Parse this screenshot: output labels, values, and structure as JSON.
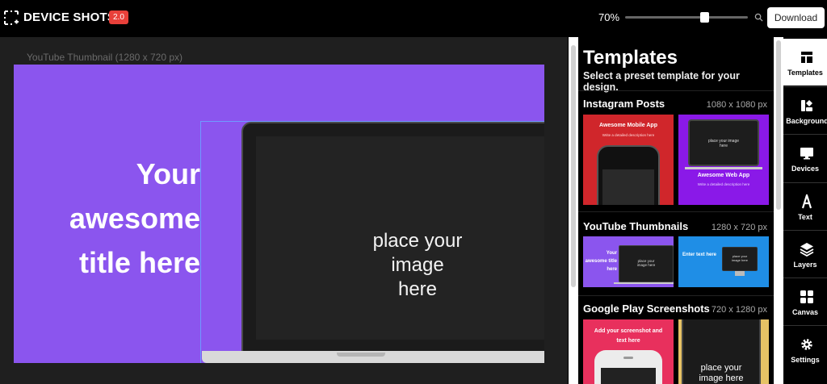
{
  "app": {
    "name": "DEVICE SHOTS",
    "version": "2.0"
  },
  "toolbar": {
    "zoom": "70%",
    "zoom_value": 0.7,
    "download_label": "Download"
  },
  "canvas": {
    "title": "YouTube Thumbnail (1280 x 720 px)",
    "headline_lines": [
      "Your",
      "awesome",
      "title here"
    ],
    "placeholder_lines": [
      "place your",
      "image here"
    ],
    "background_color": "#8b55ee"
  },
  "templates": {
    "title": "Templates",
    "subtitle": "Select a preset template for your design.",
    "sections": [
      {
        "name": "Instagram Posts",
        "size": "1080 x 1080 px",
        "thumbs": [
          {
            "title": "Awesome Mobile App",
            "desc": "Write a detailed description here",
            "color": "#d0262b"
          },
          {
            "title": "Awesome Web App",
            "desc": "Write a detailed description here",
            "placeholder": "place your image here",
            "color": "#8a19e8"
          }
        ]
      },
      {
        "name": "YouTube Thumbnails",
        "size": "1280 x 720 px",
        "thumbs": [
          {
            "title": "Your awesome title here",
            "placeholder": "place your image here",
            "color": "#8b55ee"
          },
          {
            "title": "Enter text here",
            "placeholder": "place your image here",
            "color": "#1f8ee6"
          }
        ]
      },
      {
        "name": "Google Play Screenshots",
        "size": "720 x 1280 px",
        "thumbs": [
          {
            "title": "Add your screenshot and text here",
            "color": "#e8305d"
          },
          {
            "placeholder": "place your image here",
            "color": "#e6c265"
          }
        ]
      }
    ]
  },
  "nav": [
    {
      "label": "Templates",
      "icon": "templates-icon",
      "active": true
    },
    {
      "label": "Backgrounds",
      "icon": "backgrounds-icon",
      "active": false
    },
    {
      "label": "Devices",
      "icon": "devices-icon",
      "active": false
    },
    {
      "label": "Text",
      "icon": "text-icon",
      "active": false
    },
    {
      "label": "Layers",
      "icon": "layers-icon",
      "active": false
    },
    {
      "label": "Canvas",
      "icon": "canvas-icon",
      "active": false
    },
    {
      "label": "Settings",
      "icon": "settings-icon",
      "active": false
    }
  ]
}
